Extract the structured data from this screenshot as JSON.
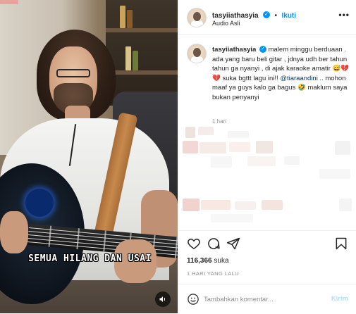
{
  "post": {
    "username": "tasyiiathasyia",
    "follow_label": "Ikuti",
    "audio_label": "Audio Asli",
    "video_caption": "SEMUA HILANG DAN USAI",
    "caption_username": "tasyiiathasyia",
    "caption_text_1": "malem minggu berduaan . ada yang baru beli gitar , jdnya udh ber tahun tahun ga nyanyi , di ajak karaoke amatir ",
    "caption_emoji": "😅💔💔",
    "caption_text_2": " suka bgttt lagu ini!! ",
    "caption_mention": "@tiaraandini",
    "caption_text_3": " .. mohon maaf ya guys kalo ga bagus ",
    "caption_emoji_2": "🤣",
    "caption_text_4": " maklum saya bukan penyanyi",
    "time_ago": "1 hari",
    "likes_count": "116,366",
    "likes_label": "suka",
    "date_label": "1 HARI YANG LALU",
    "comment_placeholder": "Tambahkan komentar...",
    "post_button": "Kirim"
  },
  "colors": {
    "accent": "#0095f6",
    "verified": "#0095f6",
    "post_button_disabled": "#b3dffc",
    "muted_text": "#8e8e8e"
  },
  "icons": {
    "like": "heart-icon",
    "comment": "comment-icon",
    "share": "send-icon",
    "save": "bookmark-icon",
    "emoji": "smiley-icon",
    "more": "more-options-icon",
    "mute": "speaker-icon",
    "verified": "verified-badge-icon"
  }
}
